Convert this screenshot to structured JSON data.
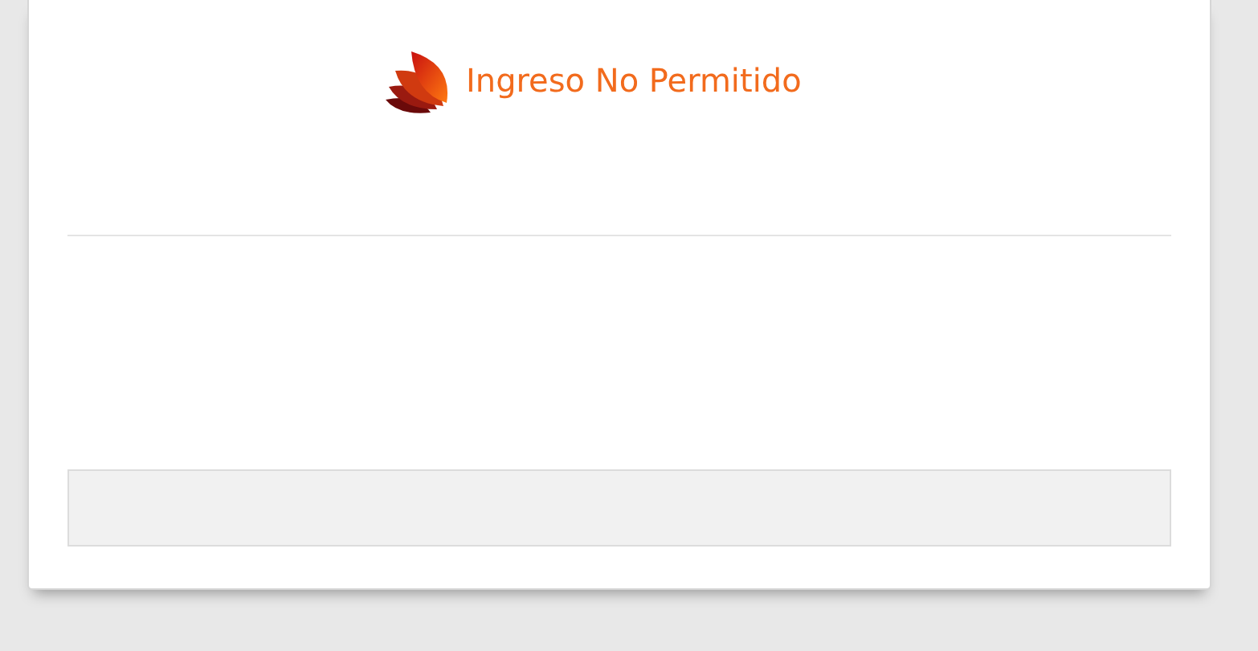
{
  "header": {
    "title": "Ingreso No Permitido"
  }
}
